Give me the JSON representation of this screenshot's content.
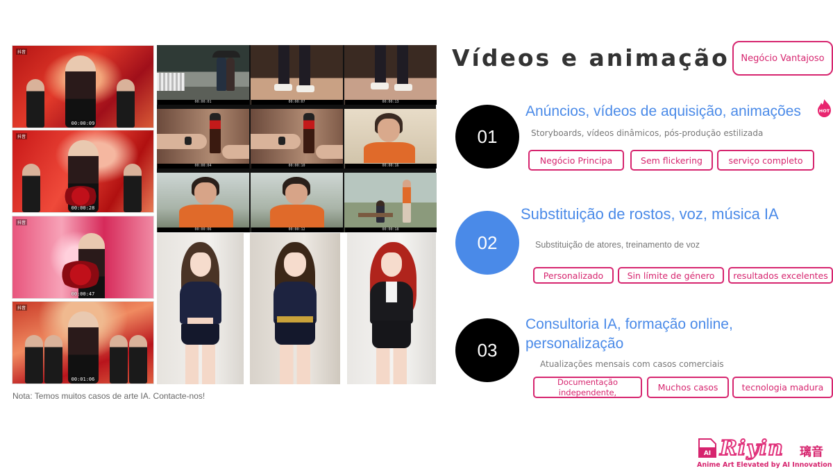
{
  "gallery": {
    "dance_frames": [
      {
        "tag": "抖音",
        "timecode": "00:00:09"
      },
      {
        "tag": "抖音",
        "timecode": "00:00:28"
      },
      {
        "tag": "抖音",
        "timecode": "00:00:47"
      },
      {
        "tag": "抖音",
        "timecode": "00:01:06"
      }
    ],
    "still_timecodes": [
      "00:00:01",
      "00:00:07",
      "00:00:13",
      "00:00:04",
      "00:00:10",
      "00:00:16",
      "00:00:06",
      "00:00:12",
      "00:00:18"
    ],
    "note": "Nota: Temos muitos casos de arte IA. Contacte-nos!"
  },
  "header": {
    "title": "Vídeos e animação IA",
    "badge": "Negócio Vantajoso"
  },
  "services": [
    {
      "number": "01",
      "title": "Anúncios, vídeos de aquisição, animações",
      "hot_label": "HOT",
      "description": "Storyboards, vídeos dinâmicos, pós-produção estilizada",
      "tags": [
        "Negócio Principa",
        "Sem flickering",
        "serviço completo"
      ]
    },
    {
      "number": "02",
      "title": "Substituição de rostos, voz, música IA",
      "description": "Substituição de atores, treinamento de voz",
      "tags": [
        "Personalizado",
        "Sin límite de género",
        "resultados excelentes"
      ]
    },
    {
      "number": "03",
      "title": "Consultoria IA, formação online, personalização",
      "description": "Atualizações mensais com casos comerciais",
      "tags": [
        "Documentação independente,",
        "Muchos casos",
        "tecnologia madura"
      ]
    }
  ],
  "logo": {
    "ai_mark": "AI",
    "wordmark": "Riyin",
    "cjk": "璃音",
    "tagline": "Anime Art Elevated by AI Innovation"
  },
  "colors": {
    "accent_pink": "#d6246e",
    "title_blue": "#4a8ae8",
    "circle_black": "#000000",
    "circle_blue": "#4a8ae8"
  },
  "icons": [
    "hot-flame-icon",
    "riyin-logo-icon"
  ]
}
